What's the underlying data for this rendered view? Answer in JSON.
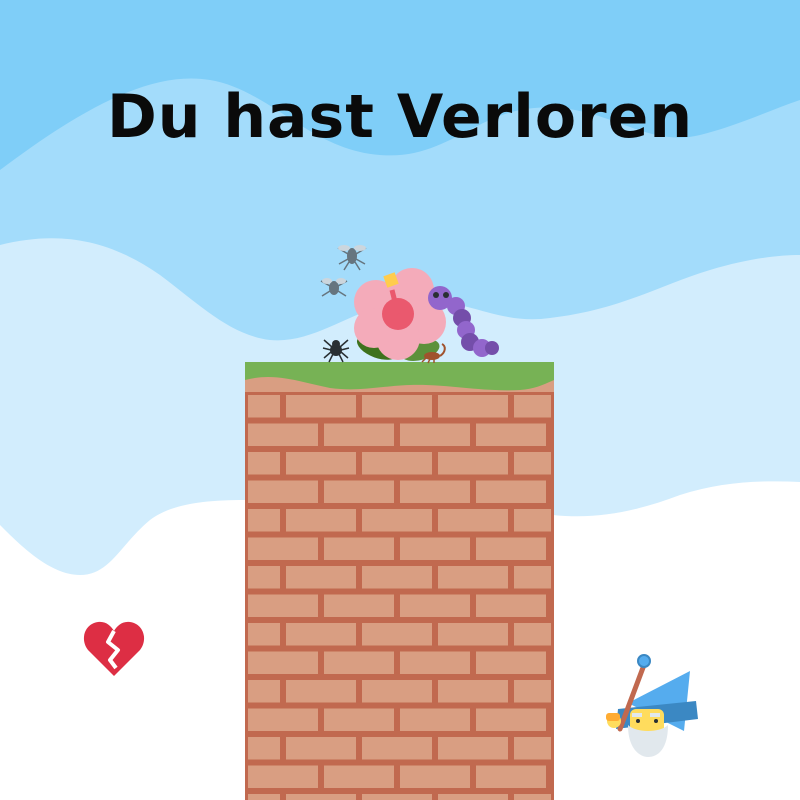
{
  "title": "Du hast Verloren",
  "sprites": {
    "lives": "broken-heart-icon",
    "player": "mage-icon",
    "pests": [
      "spider-icon",
      "mosquito-icon",
      "scorpion-icon",
      "caterpillar-icon"
    ],
    "plant": "hibiscus-icon"
  },
  "colors": {
    "sky_top": "#7fcef8",
    "sky_mid": "#a3dcfb",
    "sky_low": "#d2edfd",
    "ground": "#ffffff",
    "grass": "#77b255",
    "brick": "#d99e82",
    "mortar": "#c1694f",
    "heart": "#dd2e44",
    "caterpillar": "#9266cc",
    "wizard_hat": "#55acee"
  }
}
